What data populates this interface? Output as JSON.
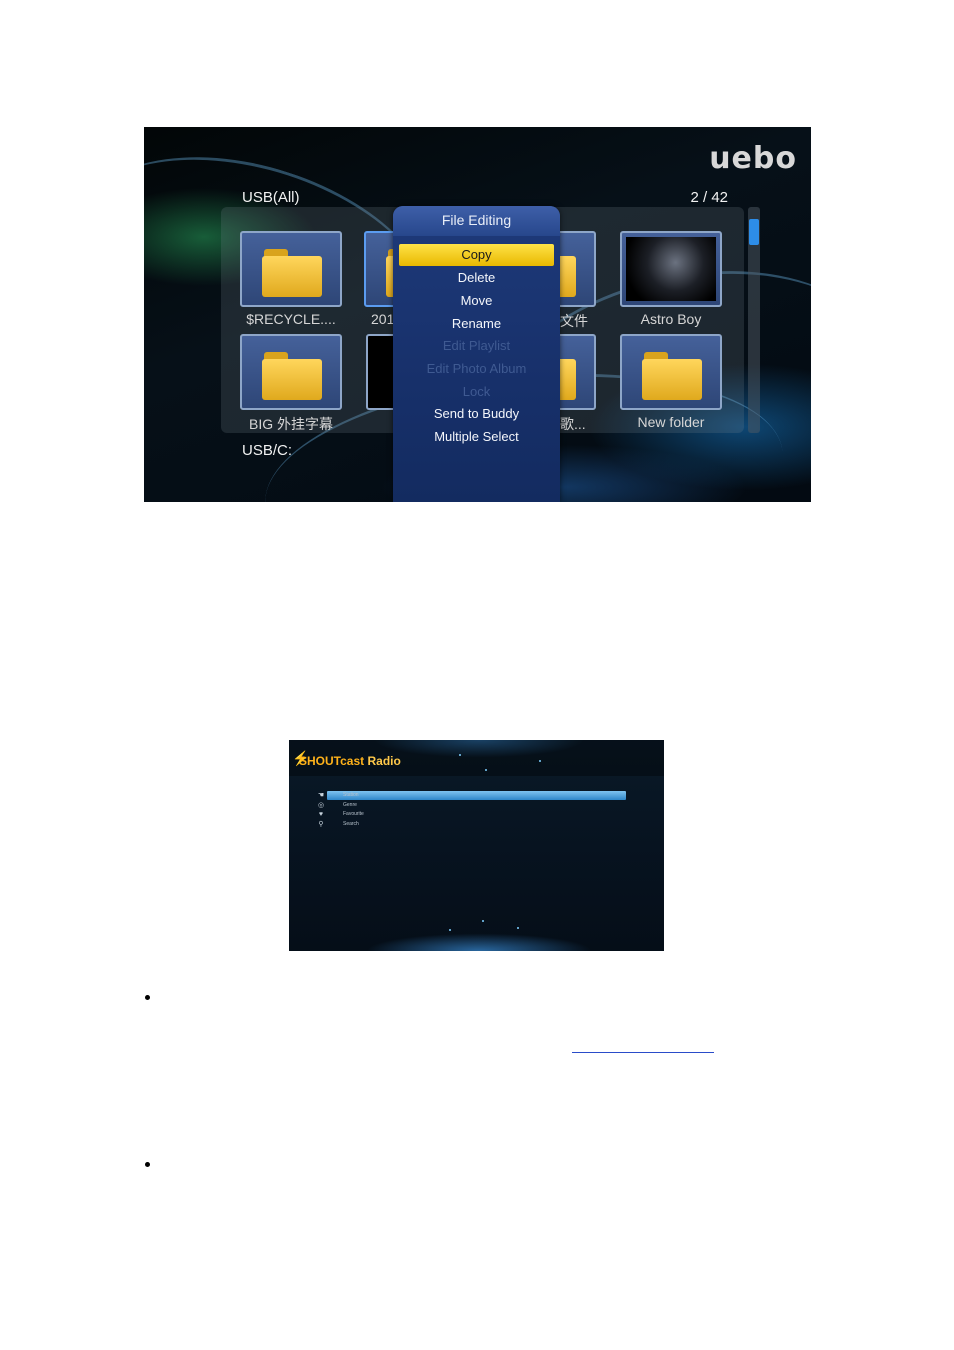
{
  "file_browser": {
    "brand": "uebo",
    "location": "USB(All)",
    "page_counter": "2 / 42",
    "footer_location": "USB/C:",
    "tiles": [
      {
        "caption": "$RECYCLE....",
        "kind": "folder"
      },
      {
        "caption": "201",
        "kind": "folder-partial"
      },
      {
        "caption": "文件",
        "kind": "folder-partial"
      },
      {
        "caption": "Astro Boy",
        "kind": "poster"
      },
      {
        "caption": "BIG 外挂字幕",
        "kind": "folder"
      },
      {
        "caption": "",
        "kind": "dark"
      },
      {
        "caption": "歌...",
        "kind": "folder-partial"
      },
      {
        "caption": "New folder",
        "kind": "folder"
      }
    ],
    "menu": {
      "title": "File Editing",
      "items": [
        {
          "label": "Copy",
          "state": "active"
        },
        {
          "label": "Delete",
          "state": "enabled"
        },
        {
          "label": "Move",
          "state": "enabled"
        },
        {
          "label": "Rename",
          "state": "enabled"
        },
        {
          "label": "Edit Playlist",
          "state": "disabled"
        },
        {
          "label": "Edit Photo Album",
          "state": "disabled"
        },
        {
          "label": "Lock",
          "state": "disabled"
        },
        {
          "label": "Send to Buddy",
          "state": "enabled"
        },
        {
          "label": "Multiple Select",
          "state": "enabled"
        }
      ]
    },
    "colors": {
      "highlight": "#f5cc1f",
      "menu_bg": "#1b3570",
      "scroll_thumb": "#2d8de8"
    }
  },
  "shoutcast": {
    "logo_main": "SHOUTcast",
    "logo_sub": "Radio",
    "items": [
      {
        "icon": "hand-icon",
        "label": "Station",
        "selected": true
      },
      {
        "icon": "genre-icon",
        "label": "Genre",
        "selected": false
      },
      {
        "icon": "heart-icon",
        "label": "Favourite",
        "selected": false
      },
      {
        "icon": "search-icon",
        "label": "Search",
        "selected": false
      }
    ]
  }
}
